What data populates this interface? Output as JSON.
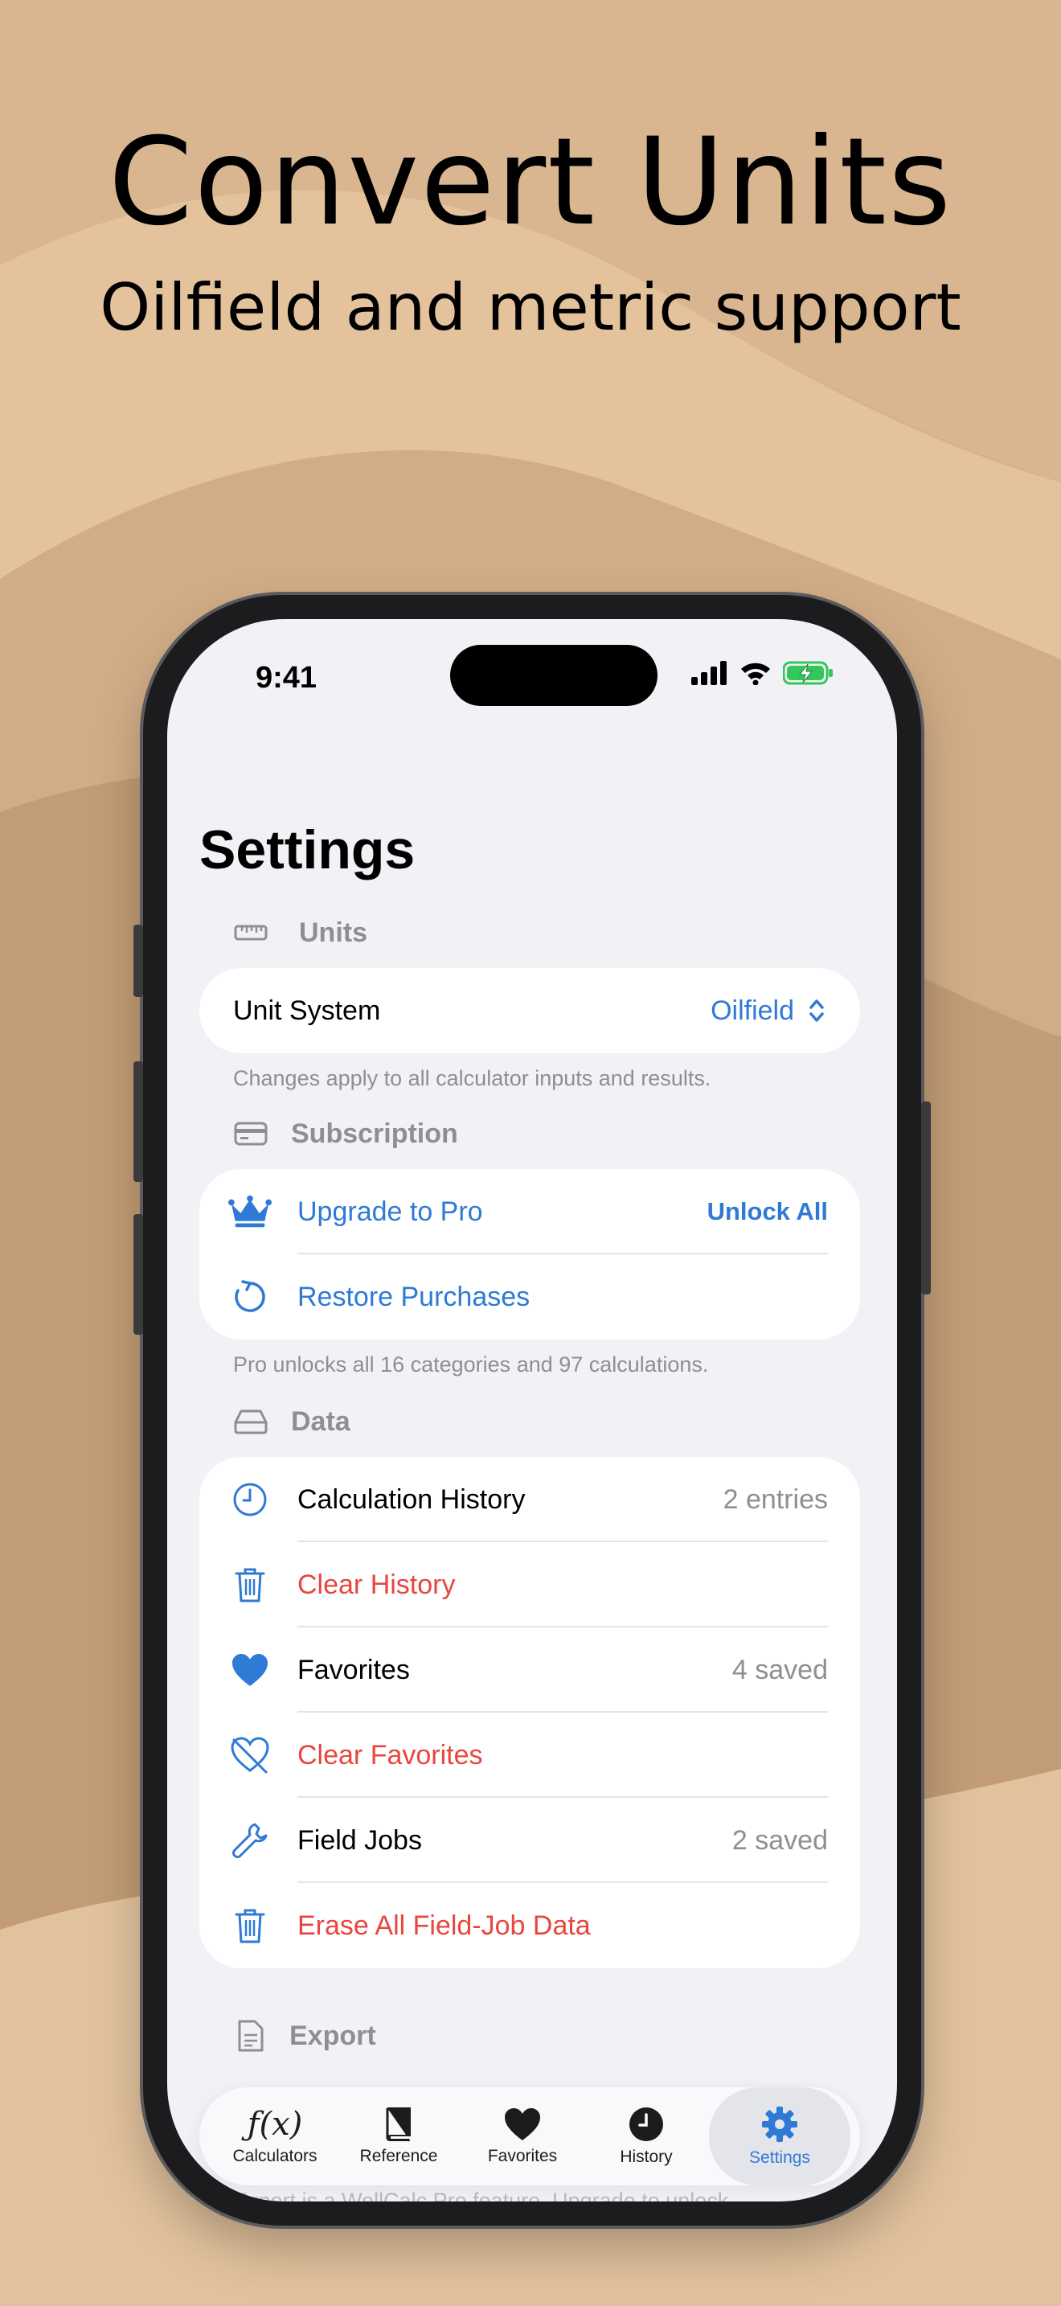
{
  "hero": {
    "title": "Convert Units",
    "subtitle": "Oilfield and metric support"
  },
  "status_bar": {
    "time": "9:41"
  },
  "screen": {
    "title": "Settings",
    "units": {
      "header": "Units",
      "unit_system_label": "Unit System",
      "unit_system_value": "Oilfield",
      "footer": "Changes apply to all calculator inputs and results."
    },
    "subscription": {
      "header": "Subscription",
      "upgrade_label": "Upgrade to Pro",
      "upgrade_action": "Unlock All",
      "restore_label": "Restore Purchases",
      "footer": "Pro unlocks all 16 categories and 97 calculations."
    },
    "data": {
      "header": "Data",
      "history_label": "Calculation History",
      "history_value": "2 entries",
      "clear_history": "Clear History",
      "favorites_label": "Favorites",
      "favorites_value": "4 saved",
      "clear_favorites": "Clear Favorites",
      "field_jobs_label": "Field Jobs",
      "field_jobs_value": "2 saved",
      "erase_field_jobs": "Erase All Field-Job Data"
    },
    "export": {
      "header": "Export",
      "footer": "Export is a WellCalc Pro feature. Upgrade to unlock"
    }
  },
  "tab_bar": {
    "tabs": [
      {
        "label": "Calculators",
        "icon": "function-icon"
      },
      {
        "label": "Reference",
        "icon": "book-icon"
      },
      {
        "label": "Favorites",
        "icon": "heart-icon"
      },
      {
        "label": "History",
        "icon": "clock-icon"
      },
      {
        "label": "Settings",
        "icon": "gear-icon"
      }
    ],
    "selected": "Settings"
  },
  "colors": {
    "accent": "#2f7ad6",
    "destructive": "#e8463f",
    "background": "#d8b58e",
    "screen_background": "#f2f1f6"
  }
}
